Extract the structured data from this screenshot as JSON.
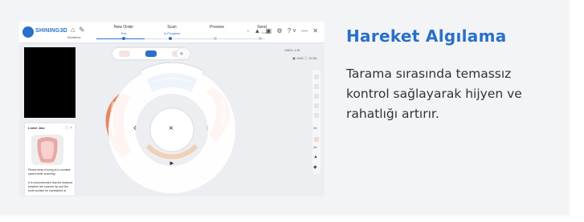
{
  "topbar": {
    "brand": "SHINING3D",
    "home_sub": "Workflow",
    "steps": [
      {
        "label": "New Order",
        "status": "Test"
      },
      {
        "label": "Scan",
        "status": "In Progress"
      },
      {
        "label": "Preview",
        "status": ""
      },
      {
        "label": "Send",
        "status": ""
      }
    ],
    "icons": "- ▲ ▣ ⚙ ?˅ — ✕",
    "right_small": "Scan"
  },
  "guide": {
    "title": "Lower Jaw",
    "tips": [
      "Please keep moving at a constant speed while scanning.",
      "It is recommended that the distance between the scanner tip and the tooth surface be maintained at"
    ]
  },
  "scan_tools": {
    "right_top": "HMDL-4 ⊕",
    "right_info": "▣ 1080  ⓘ 10:58"
  },
  "gesture_icons": {
    "left": "‹",
    "center": "×",
    "right": "›",
    "bottom": "►"
  },
  "feature": {
    "title": "Hareket Algılama",
    "description": "Tarama sırasında temassız kontrol sağlayarak hijyen ve rahatlığı artırır."
  },
  "colors": {
    "accent": "#2a6fc9",
    "card_bg": "#f2f4f6",
    "text": "#333333"
  }
}
